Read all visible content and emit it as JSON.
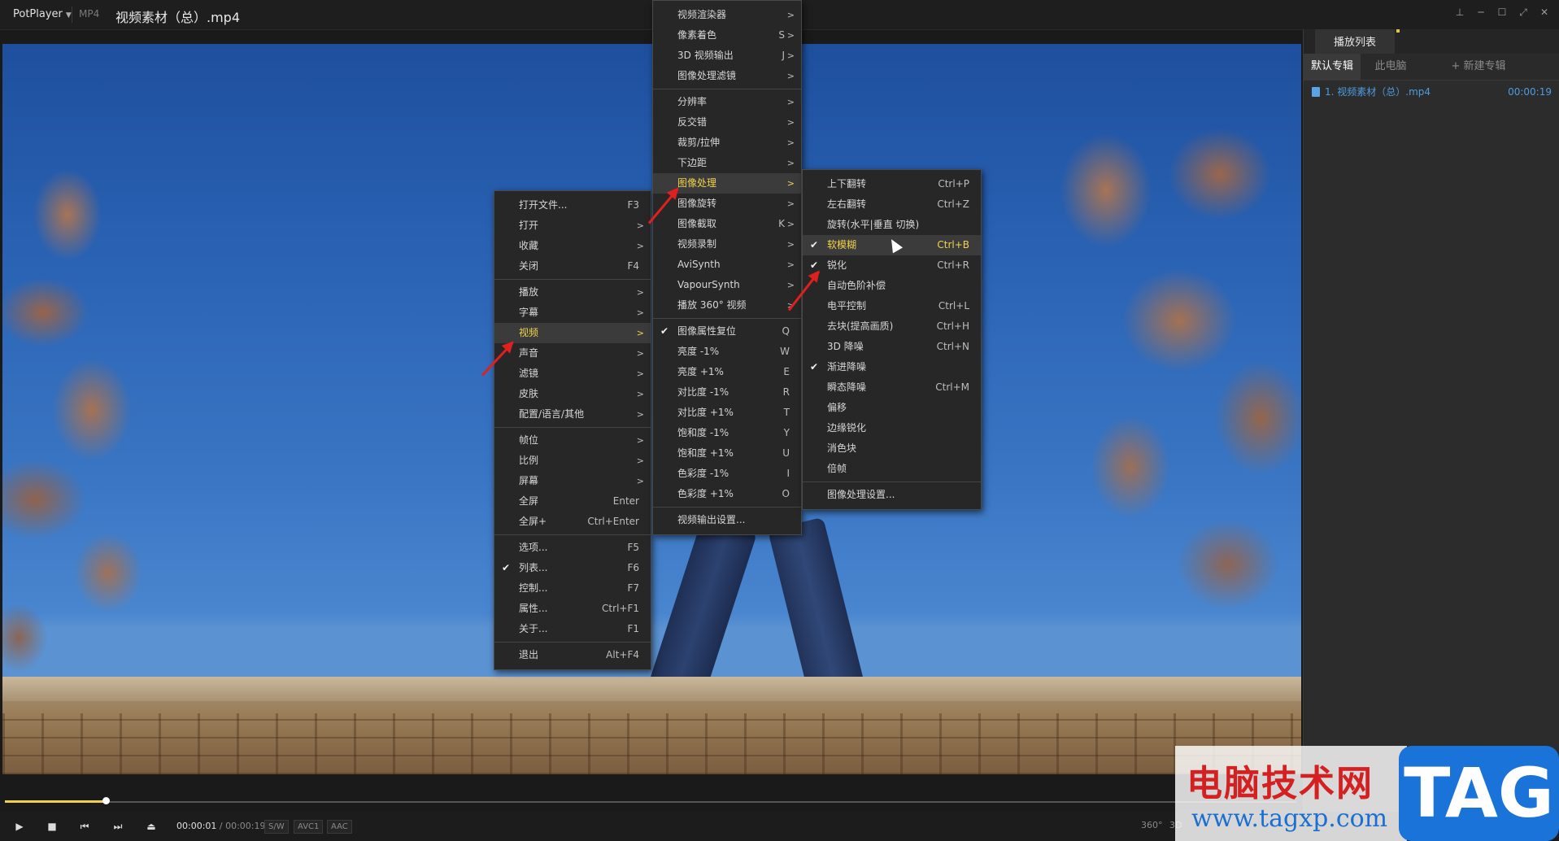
{
  "titlebar": {
    "app_label": "PotPlayer",
    "format": "MP4",
    "title": "视频素材（总）.mp4"
  },
  "playlist": {
    "tab": "播放列表",
    "subtabs": [
      "默认专辑",
      "此电脑",
      "+ 新建专辑"
    ],
    "items": [
      {
        "name": "1. 视频素材（总）.mp4",
        "duration": "00:00:19"
      }
    ]
  },
  "controls": {
    "time_current": "00:00:01",
    "time_total": "/ 00:00:19",
    "tags": [
      "S/W",
      "AVC1",
      "AAC"
    ],
    "right_labels": [
      "360°",
      "3D"
    ],
    "seek_fraction": 0.078,
    "volume_fraction": 0.7
  },
  "main_menu": [
    {
      "label": "打开文件...",
      "shortcut": "F3"
    },
    {
      "label": "打开",
      "arrow": true
    },
    {
      "label": "收藏",
      "arrow": true
    },
    {
      "label": "关闭",
      "shortcut": "F4"
    },
    {
      "sep": true
    },
    {
      "label": "播放",
      "arrow": true
    },
    {
      "label": "字幕",
      "arrow": true
    },
    {
      "label": "视频",
      "arrow": true,
      "highlight": true
    },
    {
      "label": "声音",
      "arrow": true
    },
    {
      "label": "滤镜",
      "arrow": true
    },
    {
      "label": "皮肤",
      "arrow": true
    },
    {
      "label": "配置/语言/其他",
      "arrow": true
    },
    {
      "sep": true
    },
    {
      "label": "帧位",
      "arrow": true
    },
    {
      "label": "比例",
      "arrow": true
    },
    {
      "label": "屏幕",
      "arrow": true
    },
    {
      "label": "全屏",
      "shortcut": "Enter"
    },
    {
      "label": "全屏+",
      "shortcut": "Ctrl+Enter"
    },
    {
      "sep": true
    },
    {
      "label": "选项...",
      "shortcut": "F5"
    },
    {
      "label": "列表...",
      "shortcut": "F6",
      "checked": true
    },
    {
      "label": "控制...",
      "shortcut": "F7"
    },
    {
      "label": "属性...",
      "shortcut": "Ctrl+F1"
    },
    {
      "label": "关于...",
      "shortcut": "F1"
    },
    {
      "sep": true
    },
    {
      "label": "退出",
      "shortcut": "Alt+F4"
    }
  ],
  "video_menu": [
    {
      "label": "视频渲染器",
      "arrow": true
    },
    {
      "label": "像素着色",
      "shortcut": "S",
      "arrow": true
    },
    {
      "label": "3D 视频输出",
      "shortcut": "J",
      "arrow": true
    },
    {
      "label": "图像处理滤镜",
      "arrow": true
    },
    {
      "sep": true
    },
    {
      "label": "分辨率",
      "arrow": true
    },
    {
      "label": "反交错",
      "arrow": true
    },
    {
      "label": "裁剪/拉伸",
      "arrow": true
    },
    {
      "label": "下边距",
      "arrow": true
    },
    {
      "label": "图像处理",
      "arrow": true,
      "highlight": true
    },
    {
      "label": "图像旋转",
      "arrow": true
    },
    {
      "label": "图像截取",
      "shortcut": "K",
      "arrow": true
    },
    {
      "label": "视频录制",
      "arrow": true
    },
    {
      "label": "AviSynth",
      "arrow": true
    },
    {
      "label": "VapourSynth",
      "arrow": true
    },
    {
      "label": "播放 360° 视频",
      "arrow": true
    },
    {
      "sep": true
    },
    {
      "label": "图像属性复位",
      "shortcut": "Q",
      "checked": true
    },
    {
      "label": "亮度 -1%",
      "shortcut": "W"
    },
    {
      "label": "亮度 +1%",
      "shortcut": "E"
    },
    {
      "label": "对比度 -1%",
      "shortcut": "R"
    },
    {
      "label": "对比度 +1%",
      "shortcut": "T"
    },
    {
      "label": "饱和度 -1%",
      "shortcut": "Y"
    },
    {
      "label": "饱和度 +1%",
      "shortcut": "U"
    },
    {
      "label": "色彩度 -1%",
      "shortcut": "I"
    },
    {
      "label": "色彩度 +1%",
      "shortcut": "O"
    },
    {
      "sep": true
    },
    {
      "label": "视频输出设置..."
    }
  ],
  "image_menu": [
    {
      "label": "上下翻转",
      "shortcut": "Ctrl+P"
    },
    {
      "label": "左右翻转",
      "shortcut": "Ctrl+Z"
    },
    {
      "label": "旋转(水平|垂直 切换)"
    },
    {
      "label": "软模糊",
      "shortcut": "Ctrl+B",
      "checked": true,
      "highlight": true
    },
    {
      "label": "锐化",
      "shortcut": "Ctrl+R",
      "checked": true
    },
    {
      "label": "自动色阶补偿"
    },
    {
      "label": "电平控制",
      "shortcut": "Ctrl+L"
    },
    {
      "label": "去块(提高画质)",
      "shortcut": "Ctrl+H"
    },
    {
      "label": "3D 降噪",
      "shortcut": "Ctrl+N"
    },
    {
      "label": "渐进降噪",
      "checked": true
    },
    {
      "label": "瞬态降噪",
      "shortcut": "Ctrl+M"
    },
    {
      "label": "偏移"
    },
    {
      "label": "边缘锐化"
    },
    {
      "label": "消色块"
    },
    {
      "label": "倍帧"
    },
    {
      "sep": true
    },
    {
      "label": "图像处理设置..."
    }
  ],
  "watermark": {
    "title": "电脑技术网",
    "url": "www.tagxp.com",
    "tag": "TAG"
  }
}
